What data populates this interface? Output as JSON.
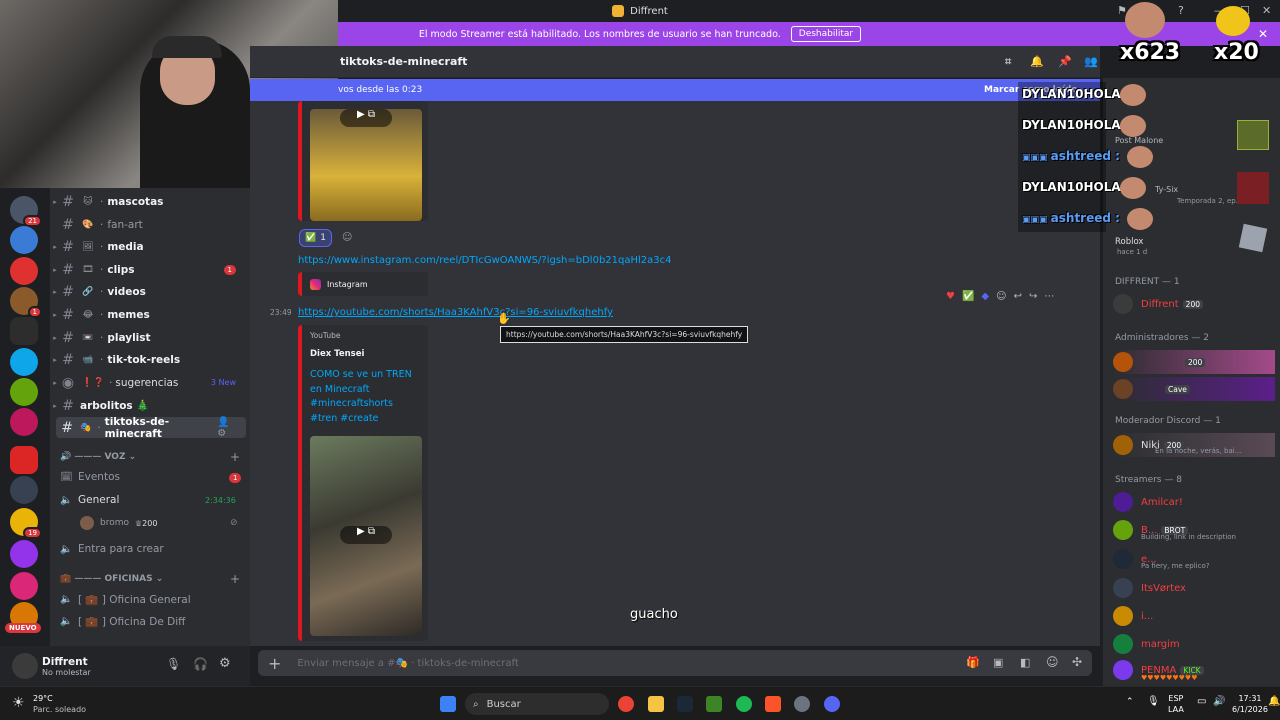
{
  "window": {
    "title": "Diffrent"
  },
  "streamer_bar": {
    "text": "El modo Streamer está habilitado. Los nombres de usuario se han truncado.",
    "button": "Deshabilitar"
  },
  "channels": [
    {
      "emoji": "🐱",
      "label": "mascotas",
      "bold": true
    },
    {
      "emoji": "🎨",
      "label": "fan-art",
      "bold": false
    },
    {
      "emoji": "🖼",
      "label": "media",
      "bold": true
    },
    {
      "emoji": "🎞",
      "label": "clips",
      "bold": true,
      "count": "1"
    },
    {
      "emoji": "🔗",
      "label": "videos",
      "bold": true
    },
    {
      "emoji": "😂",
      "label": "memes",
      "bold": true
    },
    {
      "emoji": "📼",
      "label": "playlist",
      "bold": true
    },
    {
      "emoji": "📹",
      "label": "tik-tok-reels",
      "bold": true
    },
    {
      "emoji": "❗❓",
      "label": "sugerencias",
      "bold": false,
      "newtag": "3 New"
    },
    {
      "emoji": "",
      "label": "arbolitos 🎄",
      "bold": true
    },
    {
      "emoji": "🎭",
      "label": "tiktoks-de-minecraft",
      "bold": true,
      "active": true
    }
  ],
  "voice_category": "VOZ",
  "voice": {
    "eventos": "Eventos",
    "eventos_count": "1",
    "general": "General",
    "general_time": "2:34:36",
    "user": "bromo",
    "user_badge": "200",
    "create": "Entra para crear"
  },
  "office_category": "OFICINAS",
  "offices": [
    "[ 💼 ] Oficina General",
    "[ 💼 ] Oficina De Diff"
  ],
  "user_panel": {
    "name": "Diffrent",
    "status": "No molestar"
  },
  "server_badges": {
    "s1": "21",
    "s5": "1",
    "s11": "19",
    "nuevo": "NUEVO"
  },
  "header": {
    "channel": "tiktoks-de-minecraft"
  },
  "new_messages": {
    "text": "vos desde las 0:23",
    "mark": "Marcar como leído"
  },
  "messages": {
    "reaction_count": "1",
    "instagram_link": "https://www.instagram.com/reel/DTIcGwOANWS/?igsh=bDl0b21qaHl2a3c4",
    "instagram_label": "Instagram",
    "timestamp": "23:49",
    "youtube_link": "https://youtube.com/shorts/Haa3KAhfV3c?si=96-sviuvfkqhehfy",
    "tooltip": "https://youtube.com/shorts/Haa3KAhfV3c?si=96-sviuvfkqhehfy",
    "provider": "YouTube",
    "author": "Diex Tensei",
    "video_title": "COMO se ve un TREN en Minecraft #minecraftshorts #tren #create"
  },
  "composer": {
    "placeholder": "Enviar mensaje a #🎭 · tiktoks-de-minecraft"
  },
  "subtitle": "guacho",
  "stream_overlay": {
    "counter1": "x623",
    "counter2": "x20",
    "chat": [
      {
        "user": "DYLAN10HOLA",
        "sep": ":"
      },
      {
        "user": "DYLAN10HOLA",
        "sep": ":"
      },
      {
        "user": "ashtreed",
        "sep": ":"
      },
      {
        "user": "DYLAN10HOLA",
        "sep": ":"
      },
      {
        "user": "ashtreed",
        "sep": ":"
      }
    ]
  },
  "members": {
    "activity_peek": [
      "Post Malone",
      "Ty-Six",
      "Temporada 2, ep...",
      "Roblox",
      "hace 1 d"
    ],
    "groups": [
      {
        "title": "DIFFRENT — 1",
        "items": [
          {
            "name": "Diffrent",
            "tag": "200",
            "color": "#f23f43"
          }
        ]
      },
      {
        "title": "Administradores — 2",
        "items": [
          {
            "name": "",
            "tag": "200",
            "color": "#5865f2"
          },
          {
            "name": "",
            "tag": "Cave",
            "color": "#5865f2"
          }
        ]
      },
      {
        "title": "Moderador Discord — 1",
        "items": [
          {
            "name": "Niki",
            "tag": "200",
            "color": "#dbdee1",
            "sub": "En la noche, verás, bai..."
          }
        ]
      },
      {
        "title": "Streamers — 8",
        "items": [
          {
            "name": "Amilcar!",
            "color": "#f23f43"
          },
          {
            "name": "B...",
            "tag": "BROT",
            "color": "#f23f43",
            "sub": "Building, link in description"
          },
          {
            "name": "e...",
            "color": "#f23f43",
            "sub": "Pa fiery, me eplico?"
          },
          {
            "name": "ItsVørtex",
            "color": "#f23f43"
          },
          {
            "name": "i...",
            "color": "#f23f43"
          },
          {
            "name": "margim",
            "color": "#f23f43"
          },
          {
            "name": "PENMA",
            "tag": "KICK",
            "color": "#f23f43"
          }
        ]
      }
    ]
  },
  "taskbar": {
    "weather_temp": "29°C",
    "weather_desc": "Parc. soleado",
    "search": "Buscar",
    "lang1": "ESP",
    "lang2": "LAA",
    "time": "17:31",
    "date": "6/1/2026"
  }
}
